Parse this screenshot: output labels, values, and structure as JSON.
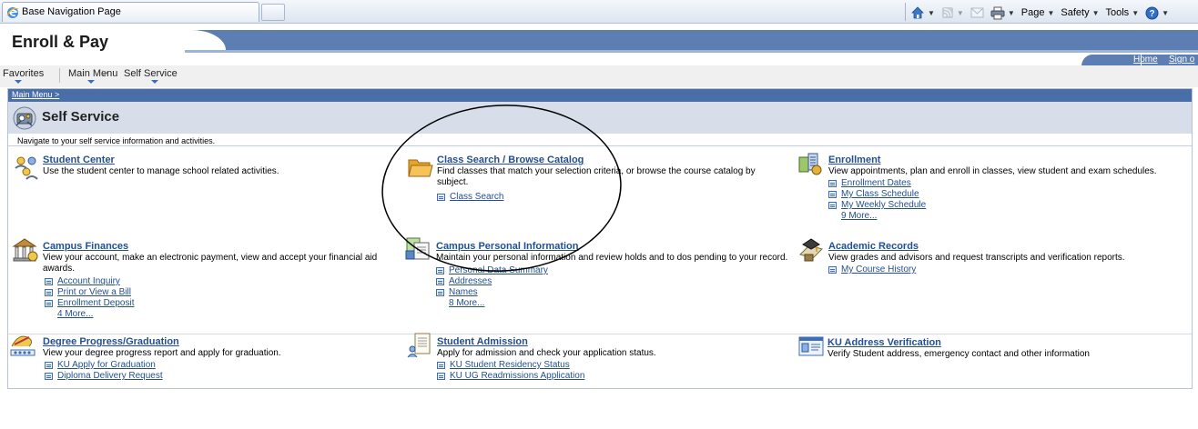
{
  "browser": {
    "tab_title": "Base Navigation Page",
    "toolbar": [
      {
        "label": "",
        "icon": "home-icon"
      },
      {
        "label": "",
        "icon": "feeds-icon"
      },
      {
        "label": "",
        "icon": "mail-icon"
      },
      {
        "label": "",
        "icon": "print-icon"
      },
      {
        "label": "Page",
        "icon": ""
      },
      {
        "label": "Safety",
        "icon": ""
      },
      {
        "label": "Tools",
        "icon": ""
      },
      {
        "label": "",
        "icon": "help-icon"
      }
    ]
  },
  "header": {
    "brand": "Enroll & Pay",
    "home_link": "Home",
    "signout_link": "Sign o"
  },
  "nav": {
    "favorites": "Favorites",
    "main_menu": "Main Menu",
    "separator": ">",
    "current": "Self Service"
  },
  "page": {
    "breadcrumb": "Main Menu >",
    "title": "Self Service",
    "instructions": "Navigate to your self service information and activities.",
    "accent_color": "#4a6fa8"
  },
  "tiles": [
    {
      "title": "Student Center",
      "description": "Use the student center to manage school related activities.",
      "icon": "student-center-icon",
      "links": []
    },
    {
      "title": "Class Search / Browse Catalog",
      "description": "Find classes that match your selection criteria, or browse the course catalog by subject.",
      "icon": "folder-icon",
      "links": [
        "Class Search"
      ]
    },
    {
      "title": "Enrollment",
      "description": "View appointments, plan and enroll in classes, view student and exam schedules.",
      "icon": "enrollment-icon",
      "links": [
        "Enrollment Dates",
        "My Class Schedule",
        "My Weekly Schedule"
      ],
      "more": "9 More..."
    },
    {
      "title": "Campus Finances",
      "description": "View your account, make an electronic payment, view and accept your financial aid awards.",
      "icon": "campus-finances-icon",
      "links": [
        "Account Inquiry",
        "Print or View a Bill",
        "Enrollment Deposit"
      ],
      "more": "4 More..."
    },
    {
      "title": "Campus Personal Information",
      "description": "Maintain your personal information and review holds and to dos pending to your record.",
      "icon": "personal-info-icon",
      "links": [
        "Personal Data Summary",
        "Addresses",
        "Names"
      ],
      "more": "8 More..."
    },
    {
      "title": "Academic Records",
      "description": "View grades and advisors and request transcripts and verification reports.",
      "icon": "academic-records-icon",
      "links": [
        "My Course History"
      ]
    },
    {
      "title": "Degree Progress/Graduation",
      "description": "View your degree progress report and apply for graduation.",
      "icon": "degree-progress-icon",
      "links": [
        "KU Apply for Graduation",
        "Diploma Delivery Request"
      ]
    },
    {
      "title": "Student Admission",
      "description": "Apply for admission and check your application status.",
      "icon": "student-admission-icon",
      "links": [
        "KU Student Residency Status",
        "KU UG Readmissions Application"
      ]
    },
    {
      "title": "KU Address Verification",
      "description": "Verify Student address, emergency contact and other information",
      "icon": "address-verification-icon",
      "links": []
    }
  ]
}
